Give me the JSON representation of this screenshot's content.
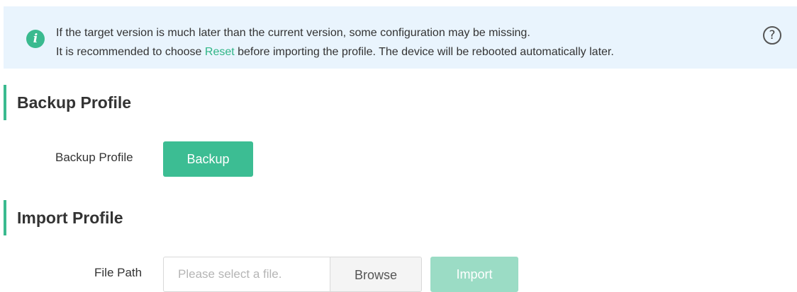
{
  "notice": {
    "line1": "If the target version is much later than the current version, some configuration may be missing.",
    "line2_before": "It is recommended to choose ",
    "reset_link": "Reset",
    "line2_after": " before importing the profile. The device will be rebooted automatically later.",
    "info_icon_glyph": "i",
    "help_icon_glyph": "?"
  },
  "backup": {
    "title": "Backup Profile",
    "label": "Backup Profile",
    "button_label": "Backup"
  },
  "import": {
    "title": "Import Profile",
    "label": "File Path",
    "placeholder": "Please select a file.",
    "browse_label": "Browse",
    "import_label": "Import"
  },
  "colors": {
    "accent": "#3aba8f",
    "notice_bg": "#e9f4fd",
    "disabled_button": "#9bdcc5"
  }
}
